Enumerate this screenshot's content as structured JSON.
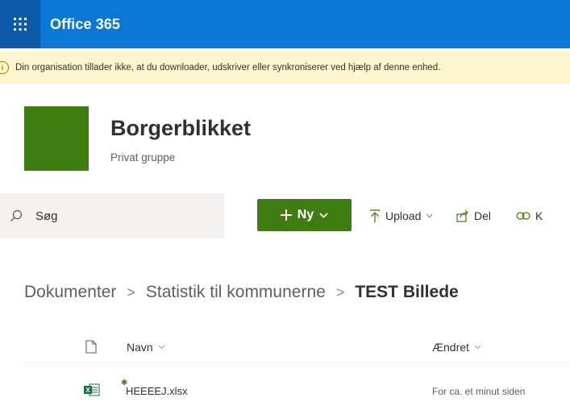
{
  "topbar": {
    "app_title": "Office 365",
    "brand_color": "#0a78d4"
  },
  "infobar": {
    "text": "Din organisation tillader ikke, at du downloader, udskriver eller synkroniserer ved hjælp af denne enhed."
  },
  "group": {
    "name": "Borgerblikket",
    "subtitle": "Privat gruppe",
    "accent_color": "#3f7d11"
  },
  "search": {
    "placeholder": "Søg"
  },
  "commands": {
    "new_label": "Ny",
    "upload_label": "Upload",
    "share_label": "Del",
    "copy_link_label": "K"
  },
  "breadcrumb": [
    "Dokumenter",
    "Statistik til kommunerne",
    "TEST Billede"
  ],
  "list": {
    "columns": {
      "name": "Navn",
      "modified": "Ændret"
    },
    "rows": [
      {
        "icon": "excel-file-icon",
        "name": "HEEEEJ.xlsx",
        "modified": "For ca. et minut siden"
      }
    ]
  }
}
